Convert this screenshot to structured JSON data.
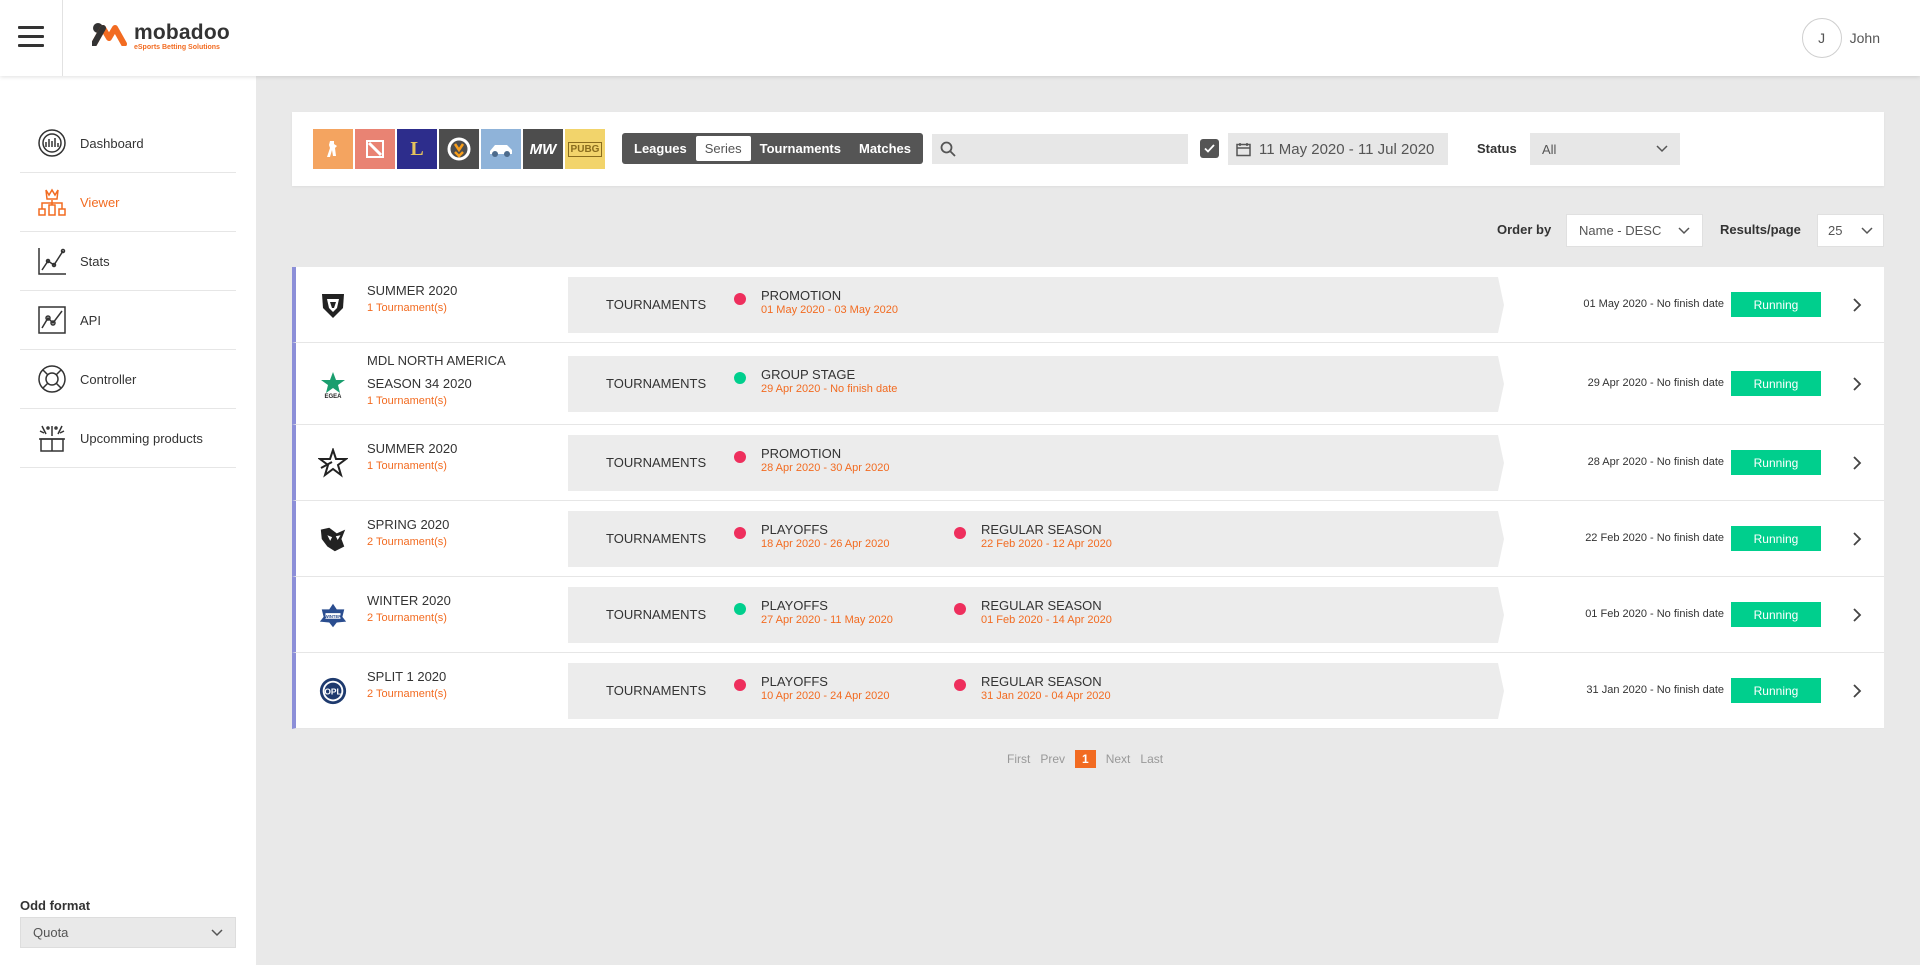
{
  "header": {
    "brand_name": "mobadoo",
    "brand_tagline": "eSports Betting Solutions",
    "user_initial": "J",
    "user_name": "John",
    "accent": "#f26b21"
  },
  "sidebar": {
    "items": [
      {
        "label": "Dashboard",
        "icon": "dashboard-icon",
        "active": false
      },
      {
        "label": "Viewer",
        "icon": "viewer-icon",
        "active": true
      },
      {
        "label": "Stats",
        "icon": "stats-icon",
        "active": false
      },
      {
        "label": "API",
        "icon": "api-icon",
        "active": false
      },
      {
        "label": "Controller",
        "icon": "controller-icon",
        "active": false
      },
      {
        "label": "Upcomming products",
        "icon": "gift-icon",
        "active": false
      }
    ],
    "odd_format_label": "Odd format",
    "odd_format_value": "Quota"
  },
  "filters": {
    "games": [
      {
        "name": "cs-go",
        "color": "#f4a460",
        "glyph": "🔫"
      },
      {
        "name": "dota-2",
        "color": "#e98373",
        "glyph": "⚔"
      },
      {
        "name": "league-of-legends",
        "color": "#2d2d8c",
        "glyph": "L"
      },
      {
        "name": "overwatch",
        "color": "#4d4d4d",
        "glyph": "◎"
      },
      {
        "name": "rocket-league",
        "color": "#8fb3d9",
        "glyph": "🚗"
      },
      {
        "name": "call-of-duty-mw",
        "color": "#4d4d4d",
        "glyph": "MW"
      },
      {
        "name": "pubg",
        "color": "#f2d46b",
        "glyph": "PUBG"
      }
    ],
    "tabs": [
      "Leagues",
      "Series",
      "Tournaments",
      "Matches"
    ],
    "active_tab": "Series",
    "search_value": "",
    "date_range": "11 May 2020 - 11 Jul 2020",
    "status_label": "Status",
    "status_value": "All"
  },
  "ordering": {
    "order_label": "Order by",
    "order_value": "Name - DESC",
    "results_label": "Results/page",
    "results_value": "25"
  },
  "series": [
    {
      "name": "SUMMER 2020",
      "tournaments": "1 Tournament(s)",
      "band_label": "TOURNAMENTS",
      "phases": [
        {
          "name": "PROMOTION",
          "dates": "01 May 2020 - 03 May 2020",
          "dot": "#ee2f5d"
        }
      ],
      "range": "01 May 2020 - No finish date",
      "status": "Running"
    },
    {
      "name": "MDL NORTH AMERICA SEASON 34 2020",
      "tournaments": "1 Tournament(s)",
      "band_label": "TOURNAMENTS",
      "phases": [
        {
          "name": "GROUP STAGE",
          "dates": "29 Apr 2020 - No finish date",
          "dot": "#00cf8d"
        }
      ],
      "range": "29 Apr 2020 - No finish date",
      "status": "Running"
    },
    {
      "name": "SUMMER 2020",
      "tournaments": "1 Tournament(s)",
      "band_label": "TOURNAMENTS",
      "phases": [
        {
          "name": "PROMOTION",
          "dates": "28 Apr 2020 - 30 Apr 2020",
          "dot": "#ee2f5d"
        }
      ],
      "range": "28 Apr 2020 - No finish date",
      "status": "Running"
    },
    {
      "name": "SPRING 2020",
      "tournaments": "2 Tournament(s)",
      "band_label": "TOURNAMENTS",
      "phases": [
        {
          "name": "PLAYOFFS",
          "dates": "18 Apr 2020 - 26 Apr 2020",
          "dot": "#ee2f5d"
        },
        {
          "name": "REGULAR SEASON",
          "dates": "22 Feb 2020 - 12 Apr 2020",
          "dot": "#ee2f5d"
        }
      ],
      "range": "22 Feb 2020 - No finish date",
      "status": "Running"
    },
    {
      "name": "WINTER 2020",
      "tournaments": "2 Tournament(s)",
      "band_label": "TOURNAMENTS",
      "phases": [
        {
          "name": "PLAYOFFS",
          "dates": "27 Apr 2020 - 11 May 2020",
          "dot": "#00cf8d"
        },
        {
          "name": "REGULAR SEASON",
          "dates": "01 Feb 2020 - 14 Apr 2020",
          "dot": "#ee2f5d"
        }
      ],
      "range": "01 Feb 2020 - No finish date",
      "status": "Running"
    },
    {
      "name": "SPLIT 1 2020",
      "tournaments": "2 Tournament(s)",
      "band_label": "TOURNAMENTS",
      "phases": [
        {
          "name": "PLAYOFFS",
          "dates": "10 Apr 2020 - 24 Apr 2020",
          "dot": "#ee2f5d"
        },
        {
          "name": "REGULAR SEASON",
          "dates": "31 Jan 2020 - 04 Apr 2020",
          "dot": "#ee2f5d"
        }
      ],
      "range": "31 Jan 2020 - No finish date",
      "status": "Running"
    }
  ],
  "pagination": {
    "first": "First",
    "prev": "Prev",
    "current": "1",
    "next": "Next",
    "last": "Last"
  }
}
